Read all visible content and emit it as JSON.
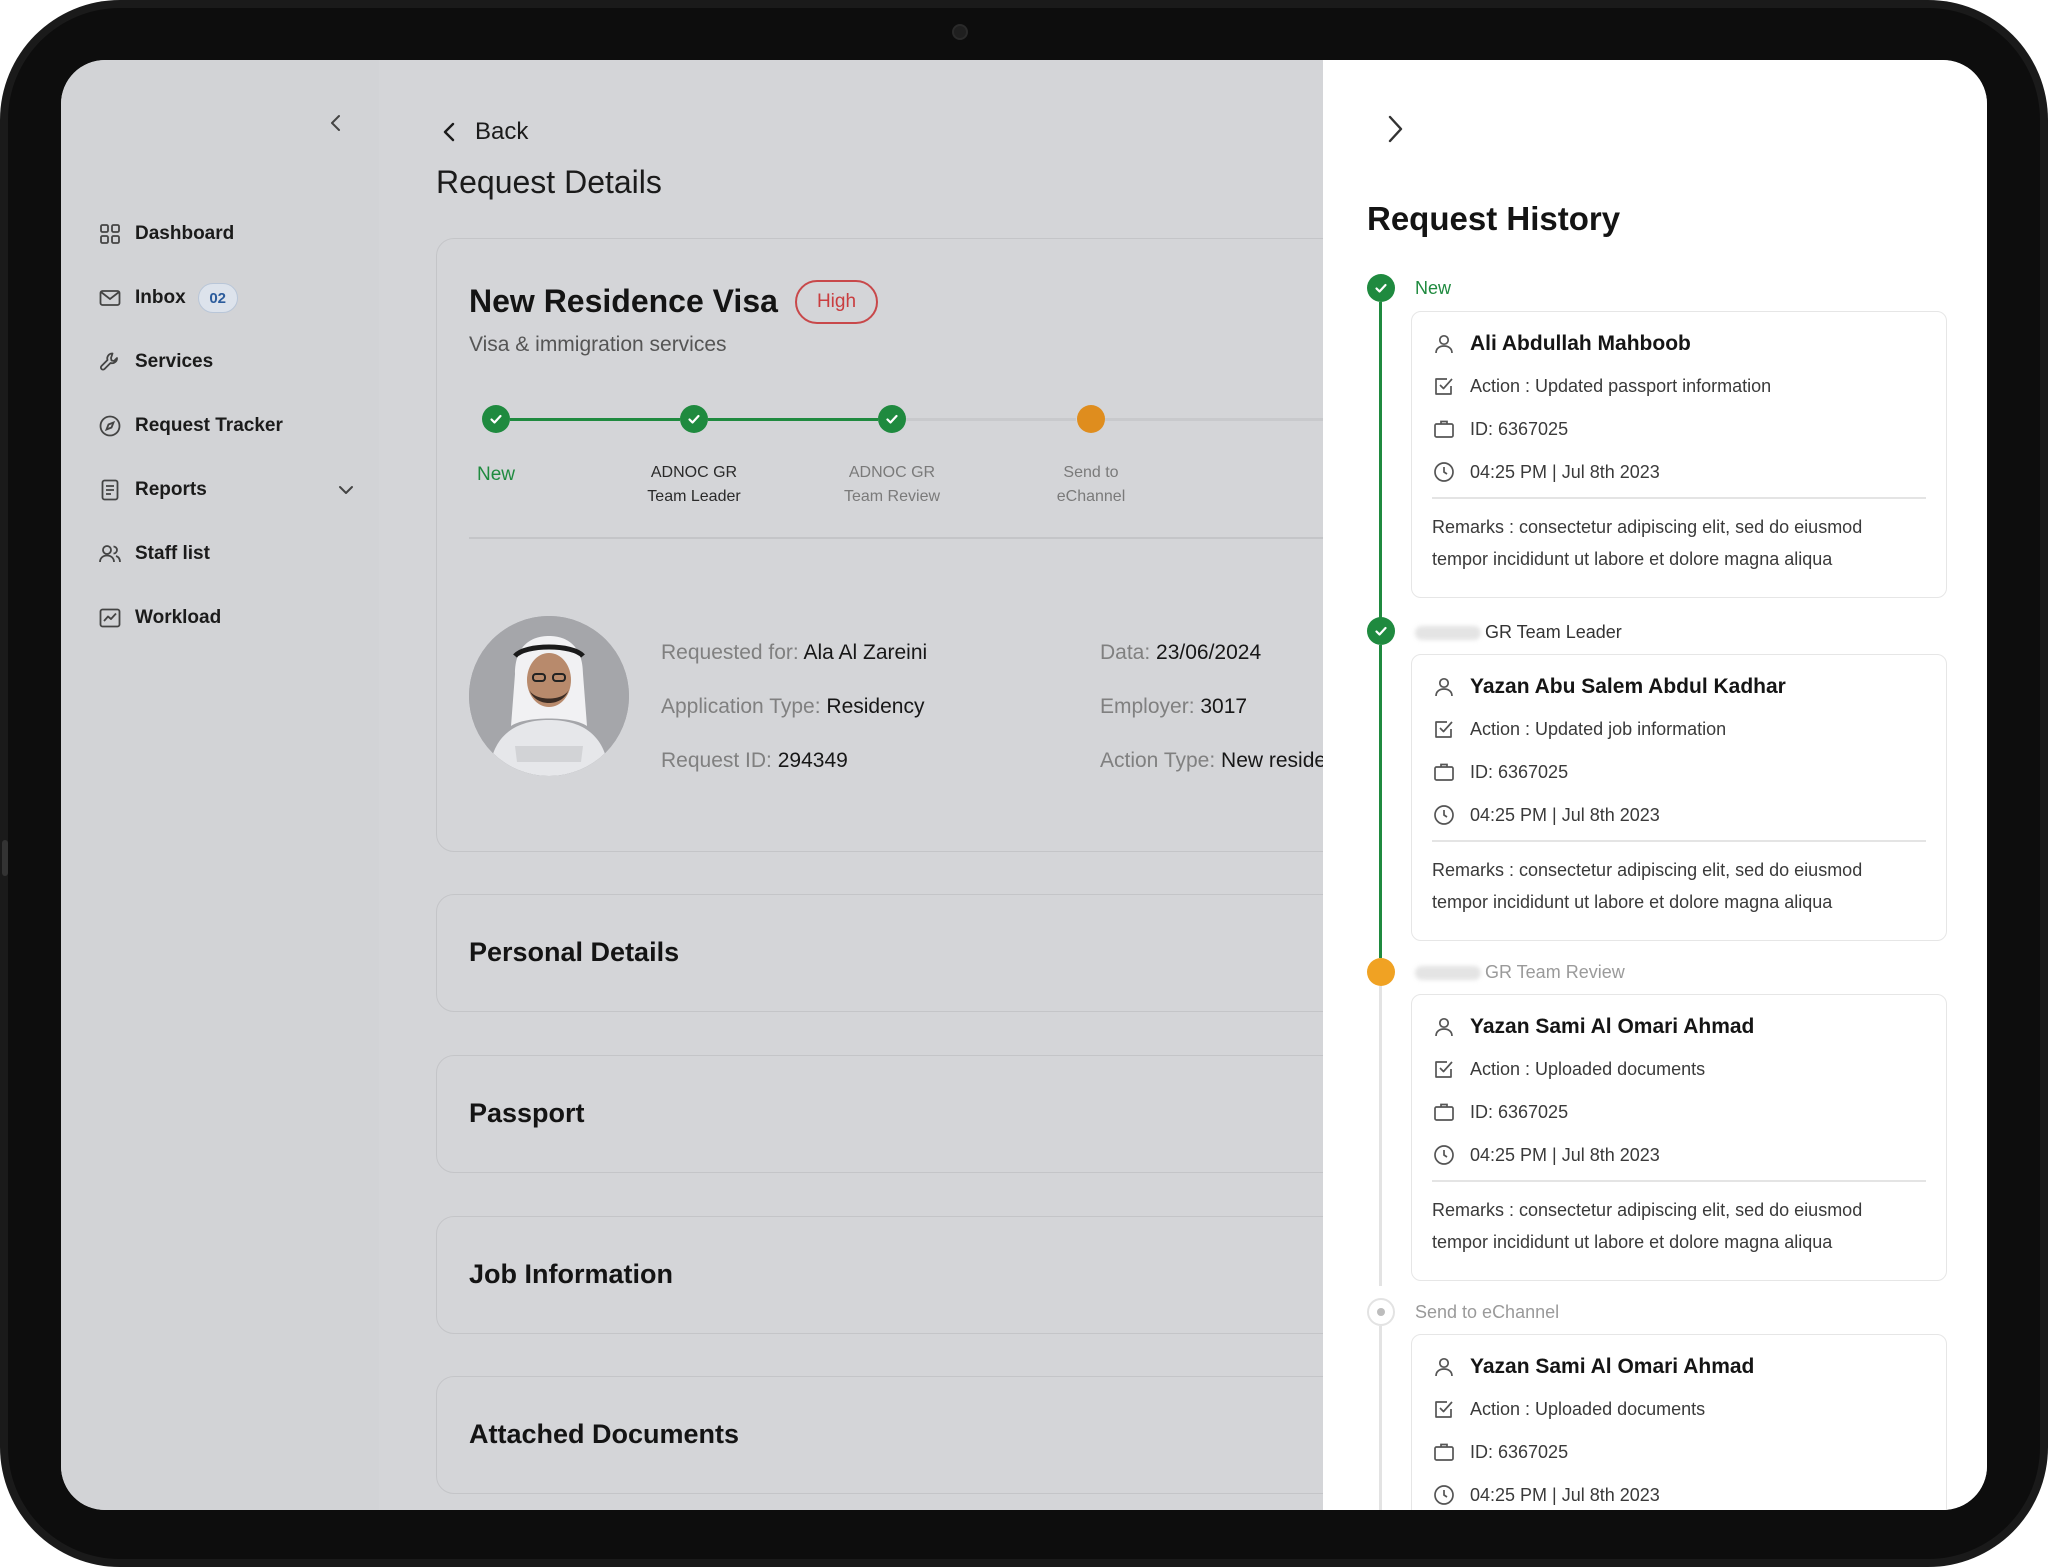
{
  "sidebar": {
    "items": [
      {
        "label": "Dashboard",
        "icon": "dashboard-icon"
      },
      {
        "label": "Inbox",
        "icon": "mail-icon",
        "badge": "02"
      },
      {
        "label": "Services",
        "icon": "wrench-icon"
      },
      {
        "label": "Request Tracker",
        "icon": "compass-icon"
      },
      {
        "label": "Reports",
        "icon": "document-icon"
      },
      {
        "label": "Staff list",
        "icon": "users-icon"
      },
      {
        "label": "Workload",
        "icon": "chart-icon"
      }
    ]
  },
  "main": {
    "back_label": "Back",
    "page_title": "Request Details",
    "request": {
      "title": "New Residence Visa",
      "priority": "High",
      "subtitle": "Visa & immigration services",
      "steps": [
        {
          "line1": "New",
          "line2": "",
          "status": "done"
        },
        {
          "line1": "ADNOC GR",
          "line2": "Team Leader",
          "status": "done"
        },
        {
          "line1": "ADNOC GR",
          "line2": "Team Review",
          "status": "done"
        },
        {
          "line1": "Send to",
          "line2": "eChannel",
          "status": "current"
        }
      ],
      "fields": {
        "requested_for_label": "Requested for:",
        "requested_for": "Ala Al Zareini",
        "application_type_label": "Application Type:",
        "application_type": "Residency",
        "request_id_label": "Request ID:",
        "request_id": "294349",
        "date_label": "Data:",
        "date": "23/06/2024",
        "employer_label": "Employer:",
        "employer": "3017",
        "action_type_label": "Action Type:",
        "action_type": "New reside"
      }
    },
    "sections": [
      "Personal Details",
      "Passport",
      "Job Information",
      "Attached Documents"
    ]
  },
  "drawer": {
    "title": "Request History",
    "entries": [
      {
        "stage": "New",
        "status": "done",
        "name": "Ali Abdullah Mahboob",
        "action": "Action : Updated passport information",
        "id": "ID: 6367025",
        "time": "04:25 PM | Jul 8th 2023",
        "remarks": "Remarks : consectetur adipiscing elit, sed do eiusmod tempor incididunt ut labore et dolore magna aliqua"
      },
      {
        "stage": "GR Team Leader",
        "status": "done",
        "name": "Yazan Abu Salem Abdul Kadhar",
        "action": "Action : Updated job information",
        "id": "ID: 6367025",
        "time": "04:25 PM | Jul 8th 2023",
        "remarks": "Remarks : consectetur adipiscing elit, sed do eiusmod tempor incididunt ut labore et dolore magna aliqua"
      },
      {
        "stage": "GR Team Review",
        "status": "current",
        "name": "Yazan Sami Al Omari Ahmad",
        "action": "Action : Uploaded documents",
        "id": "ID: 6367025",
        "time": "04:25 PM | Jul 8th 2023",
        "remarks": "Remarks : consectetur adipiscing elit, sed do eiusmod tempor incididunt ut labore et dolore magna aliqua"
      },
      {
        "stage": "Send to eChannel",
        "status": "pending",
        "name": "Yazan Sami Al Omari Ahmad",
        "action": "Action : Uploaded documents",
        "id": "ID: 6367025",
        "time": "04:25 PM | Jul 8th 2023"
      }
    ]
  },
  "colors": {
    "success": "#1f8a3f",
    "warning": "#f0a223",
    "priority_high": "#c93d3f",
    "badge_text": "#2c5c9c"
  }
}
